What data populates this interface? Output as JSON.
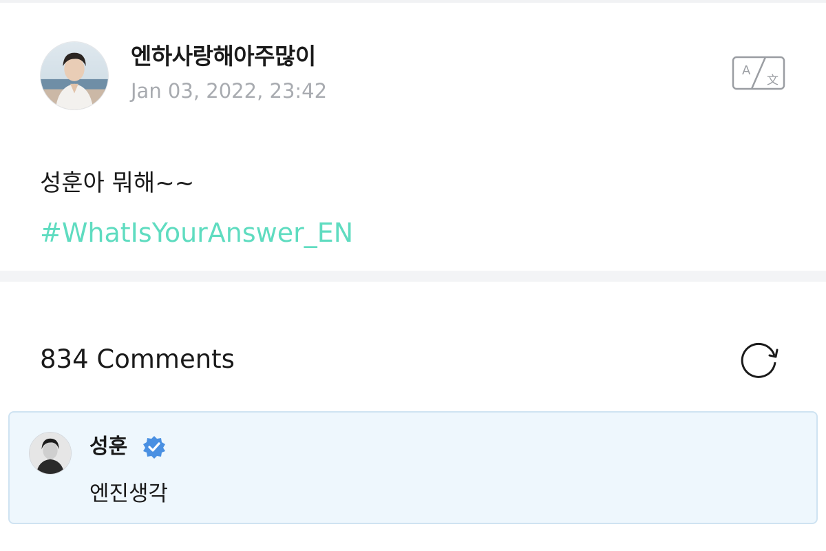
{
  "post": {
    "author": "엔하사랑해아주많이",
    "timestamp": "Jan 03, 2022, 23:42",
    "text": "성훈아 뭐해~~",
    "hashtag": "#WhatIsYourAnswer_EN",
    "avatar_icon": "profile-photo",
    "translate_icon": "translate-icon"
  },
  "comments": {
    "count_label": "834 Comments",
    "refresh_icon": "refresh-icon",
    "items": [
      {
        "author": "성훈",
        "verified": true,
        "text": "엔진생각",
        "highlighted": true
      }
    ]
  },
  "colors": {
    "hashtag": "#5fdcc0",
    "timestamp": "#a8abb0",
    "comment_bg": "#eef7fd",
    "comment_border": "#cfe3f2",
    "verified_badge": "#4a90e2",
    "divider": "#f3f4f6"
  }
}
